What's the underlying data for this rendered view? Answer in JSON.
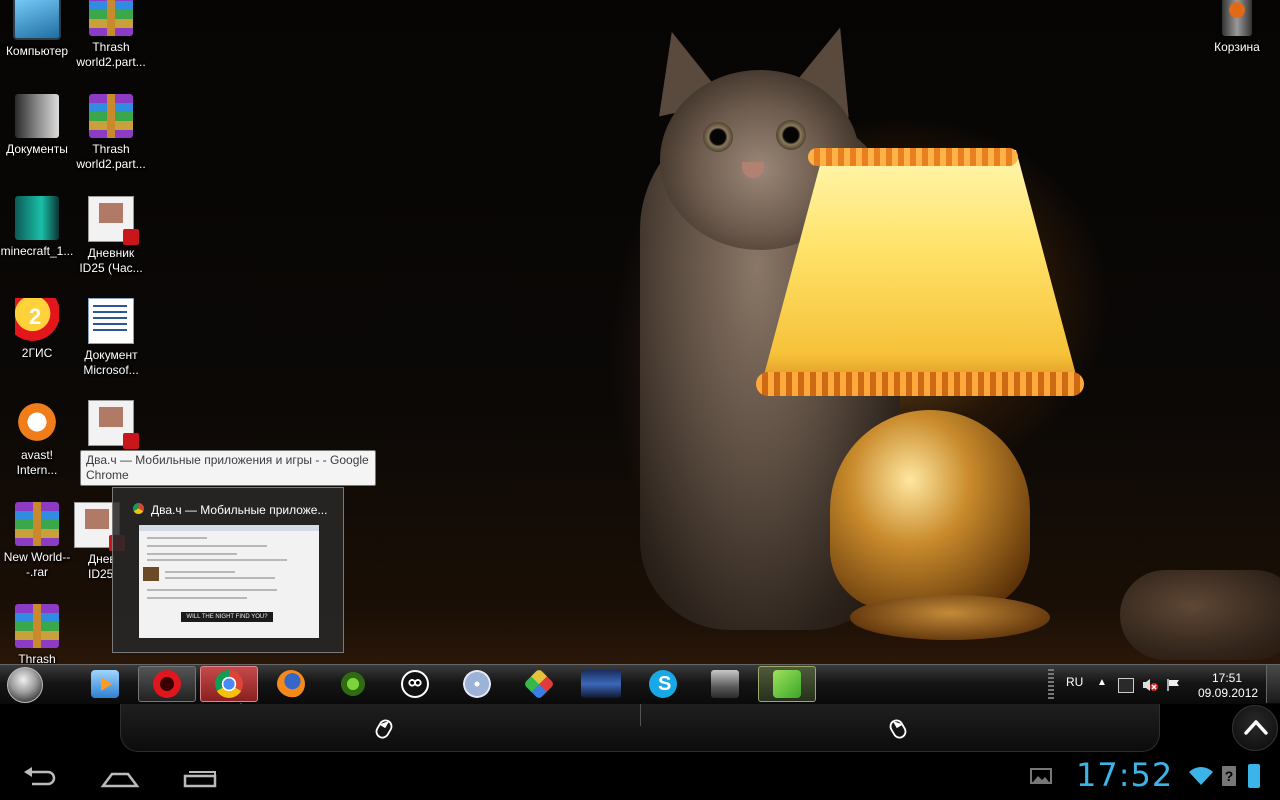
{
  "desktop": {
    "icons": [
      {
        "label": "Компьютер",
        "icon": "computer-icon"
      },
      {
        "label": "Thrash world2.part...",
        "icon": "winrar-archive-icon"
      },
      {
        "label": "Документы",
        "icon": "documents-folder-icon"
      },
      {
        "label": "Thrash world2.part...",
        "icon": "winrar-archive-icon"
      },
      {
        "label": "minecraft_1...",
        "icon": "minecraft-icon"
      },
      {
        "label": "Дневник ID25 (Час...",
        "icon": "pdf-document-icon"
      },
      {
        "label": "2ГИС",
        "icon": "2gis-icon"
      },
      {
        "label": "Документ Microsof...",
        "icon": "word-document-icon"
      },
      {
        "label": "avast! Intern...",
        "icon": "avast-icon"
      },
      {
        "label": "New World---.rar",
        "icon": "winrar-archive-icon"
      },
      {
        "label": "Днев ID25",
        "icon": "pdf-document-icon"
      },
      {
        "label": "Thrash",
        "icon": "winrar-archive-icon"
      },
      {
        "label": "Корзина",
        "icon": "recycle-bin-icon"
      }
    ]
  },
  "tooltip": {
    "text": "Два.ч — Мобильные приложения и игры - - Google Chrome"
  },
  "thumbnail": {
    "title": "Два.ч — Мобильные приложе...",
    "banner": "WILL THE NIGHT FIND YOU?"
  },
  "taskbar": {
    "apps": [
      {
        "name": "media-player",
        "icon": "media-player-icon",
        "state": "pinned"
      },
      {
        "name": "opera",
        "icon": "opera-icon",
        "state": "open"
      },
      {
        "name": "chrome",
        "icon": "chrome-icon",
        "state": "active"
      },
      {
        "name": "firefox",
        "icon": "firefox-icon",
        "state": "pinned"
      },
      {
        "name": "utorrent",
        "icon": "torrent-icon",
        "state": "pinned"
      },
      {
        "name": "icq",
        "icon": "icq-icon",
        "state": "pinned"
      },
      {
        "name": "disc",
        "icon": "disc-icon",
        "state": "pinned"
      },
      {
        "name": "cube-app",
        "icon": "cube-icon",
        "state": "pinned"
      },
      {
        "name": "game",
        "icon": "game-icon",
        "state": "pinned"
      },
      {
        "name": "skype",
        "icon": "skype-icon",
        "state": "pinned"
      },
      {
        "name": "folder",
        "icon": "folder-icon",
        "state": "pinned"
      },
      {
        "name": "splashtop",
        "icon": "splashtop-icon",
        "state": "open"
      }
    ],
    "tray": {
      "language": "RU",
      "time": "17:51",
      "date": "09.09.2012"
    }
  },
  "android": {
    "time": "17:52"
  },
  "colors": {
    "android_clock": "#3bb4e8",
    "taskbar_active": "#c54a4a",
    "battery": "#3bb4e8"
  }
}
